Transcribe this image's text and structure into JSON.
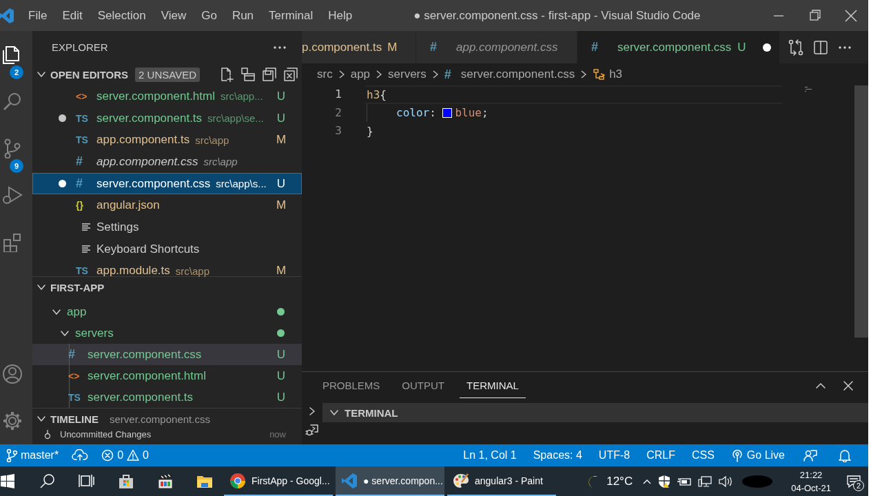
{
  "title_bar": {
    "menu": [
      "File",
      "Edit",
      "Selection",
      "View",
      "Go",
      "Run",
      "Terminal",
      "Help"
    ],
    "title": "● server.component.css - first-app - Visual Studio Code"
  },
  "activity_bar": [
    {
      "kind": "explorer",
      "selected": true,
      "badge": "2"
    },
    {
      "kind": "search",
      "selected": false
    },
    {
      "kind": "scm",
      "selected": false,
      "badge": "9"
    },
    {
      "kind": "debug",
      "selected": false
    },
    {
      "kind": "extensions",
      "selected": false
    },
    {
      "kind": "account",
      "selected": false
    },
    {
      "kind": "settings",
      "selected": false
    }
  ],
  "sidebar": {
    "title": "EXPLORER",
    "open_editors": {
      "title": "OPEN EDITORS",
      "badge": "2 UNSAVED",
      "expanded": true,
      "items": [
        {
          "kind": "html",
          "icon": "<>",
          "name": "server.component.html",
          "path": "src\\app...",
          "color": "#73c991",
          "status": "U",
          "dirty": false,
          "preview": false,
          "selected": false
        },
        {
          "kind": "ts",
          "icon": "TS",
          "name": "server.component.ts",
          "path": "src\\app\\se...",
          "color": "#73c991",
          "status": "U",
          "dirty": true,
          "preview": false,
          "selected": false
        },
        {
          "kind": "ts",
          "icon": "TS",
          "name": "app.component.ts",
          "path": "src\\app",
          "color": "#e2c08d",
          "status": "M",
          "dirty": false,
          "preview": false,
          "selected": false
        },
        {
          "kind": "css",
          "icon": "#",
          "name": "app.component.css",
          "path": "src\\app",
          "color": "#cccccc",
          "dirty": false,
          "preview": true,
          "selected": false
        },
        {
          "kind": "css",
          "icon": "#",
          "name": "server.component.css",
          "path": "src\\app\\s...",
          "color": "#ffffff",
          "status": "U",
          "dirty": true,
          "preview": false,
          "selected": true
        },
        {
          "kind": "json",
          "icon": "{}",
          "name": "angular.json",
          "color": "#e2c08d",
          "status": "M",
          "dirty": false,
          "preview": false,
          "selected": false
        },
        {
          "kind": "settings",
          "name": "Settings",
          "color": "#cccccc",
          "dirty": false,
          "preview": false,
          "selected": false
        },
        {
          "kind": "settings",
          "name": "Keyboard Shortcuts",
          "color": "#cccccc",
          "dirty": false,
          "preview": false,
          "selected": false
        },
        {
          "kind": "ts",
          "icon": "TS",
          "name": "app.module.ts",
          "path": "src\\app",
          "color": "#e2c08d",
          "status": "M",
          "dirty": false,
          "preview": false,
          "selected": false
        }
      ]
    },
    "project": {
      "title": "FIRST-APP",
      "expanded": true,
      "tree": [
        {
          "name": "app",
          "kind": "folder",
          "expanded": true,
          "color": "#73c991",
          "children": [
            {
              "name": "servers",
              "kind": "folder",
              "expanded": true,
              "color": "#73c991",
              "children": [
                {
                  "name": "server.component.css",
                  "kind": "css",
                  "icon": "#",
                  "color": "#73c991",
                  "status": "U",
                  "selected": true
                },
                {
                  "name": "server.component.html",
                  "kind": "html",
                  "icon": "<>",
                  "color": "#73c991",
                  "status": "U",
                  "selected": false
                },
                {
                  "name": "server.component.ts",
                  "kind": "ts",
                  "icon": "TS",
                  "color": "#73c991",
                  "status": "U",
                  "selected": false
                }
              ]
            }
          ]
        }
      ]
    },
    "timeline": {
      "title": "TIMELINE",
      "file": "server.component.css",
      "expanded": true,
      "entries": [
        {
          "label": "Uncommitted Changes",
          "time": "now"
        }
      ]
    }
  },
  "editor": {
    "tabs": [
      {
        "label": "p.component.ts",
        "color": "#e2c08d",
        "status": "M",
        "preview": false,
        "selected": false
      },
      {
        "kind": "css",
        "icon": "#",
        "label": "app.component.css",
        "color": "#969696",
        "preview": true,
        "selected": false
      },
      {
        "kind": "css",
        "icon": "#",
        "label": "server.component.css",
        "color": "#73c991",
        "status": "U",
        "preview": false,
        "dirty": true,
        "selected": true
      }
    ],
    "breadcrumbs": [
      {
        "kind": "folder",
        "label": "src"
      },
      {
        "kind": "folder",
        "label": "app"
      },
      {
        "kind": "folder",
        "label": "servers"
      },
      {
        "kind": "file",
        "icon": "#",
        "label": "server.component.css"
      },
      {
        "kind": "symbol",
        "label": "h3"
      }
    ],
    "lines": [
      {
        "number": "1",
        "current": true,
        "tokens": [
          {
            "kind": "selector",
            "text": "h3"
          },
          {
            "kind": "punct",
            "text": "{"
          }
        ]
      },
      {
        "number": "2",
        "current": false,
        "indent": true,
        "tokens": [
          {
            "kind": "property",
            "text": "color"
          },
          {
            "kind": "punct",
            "text": ": "
          },
          {
            "kind": "swatch",
            "color": "#0000ff"
          },
          {
            "kind": "value",
            "text": "blue"
          },
          {
            "kind": "punct",
            "text": ";"
          }
        ]
      },
      {
        "number": "3",
        "current": false,
        "tokens": [
          {
            "kind": "punct",
            "text": "}"
          }
        ]
      }
    ]
  },
  "panel": {
    "tabs": [
      {
        "label": "PROBLEMS",
        "selected": false
      },
      {
        "label": "OUTPUT",
        "selected": false
      },
      {
        "label": "TERMINAL",
        "selected": true
      }
    ],
    "section": {
      "title": "TERMINAL",
      "expanded": true
    }
  },
  "status_bar": {
    "branch": "master*",
    "errors": "0",
    "warnings": "0",
    "items": [
      {
        "kind": "text",
        "label": "Ln 1, Col 1"
      },
      {
        "kind": "text",
        "label": "Spaces: 4"
      },
      {
        "kind": "text",
        "label": "UTF-8"
      },
      {
        "kind": "text",
        "label": "CRLF"
      },
      {
        "kind": "text",
        "label": "CSS"
      },
      {
        "kind": "golive",
        "label": "Go Live"
      },
      {
        "kind": "feedback"
      },
      {
        "kind": "bell"
      }
    ]
  },
  "taskbar": {
    "apps": [
      {
        "kind": "start"
      },
      {
        "kind": "search"
      },
      {
        "kind": "taskview"
      },
      {
        "kind": "store"
      },
      {
        "kind": "media"
      },
      {
        "kind": "folder"
      },
      {
        "kind": "chrome",
        "label": "FirstApp - Googl...",
        "selected": false
      },
      {
        "kind": "vscode",
        "label": "● server.compon...",
        "selected": true
      },
      {
        "kind": "paint",
        "label": "angular3 - Paint",
        "selected": false
      }
    ],
    "weather": "12°C",
    "time": "21:22",
    "date": "04-Oct-21",
    "notifications": "2"
  }
}
